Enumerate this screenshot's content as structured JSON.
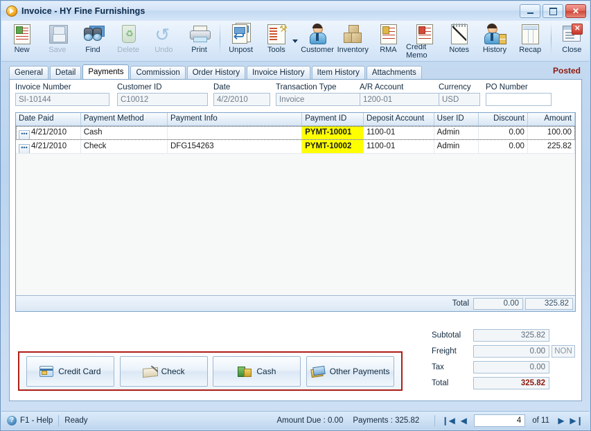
{
  "window": {
    "title": "Invoice - HY Fine Furnishings",
    "icon": "play-circle-icon",
    "controls": {
      "minimize": "minimize",
      "maximize": "maximize",
      "close": "close"
    }
  },
  "toolbar": {
    "items": [
      {
        "label": "New",
        "icon": "new-document-icon",
        "disabled": false
      },
      {
        "label": "Save",
        "icon": "floppy-disk-icon",
        "disabled": true
      },
      {
        "label": "Find",
        "icon": "binoculars-icon",
        "disabled": false
      },
      {
        "label": "Delete",
        "icon": "trash-can-icon",
        "disabled": true
      },
      {
        "label": "Undo",
        "icon": "undo-arrow-icon",
        "disabled": true
      },
      {
        "label": "Print",
        "icon": "printer-icon",
        "disabled": false
      },
      {
        "label": "Unpost",
        "icon": "unpost-pages-icon",
        "disabled": false
      },
      {
        "label": "Tools",
        "icon": "tools-wrench-icon",
        "disabled": false
      },
      {
        "label": "Customer",
        "icon": "person-icon",
        "disabled": false
      },
      {
        "label": "Inventory",
        "icon": "boxes-icon",
        "disabled": false
      },
      {
        "label": "RMA",
        "icon": "rma-document-icon",
        "disabled": false
      },
      {
        "label": "Credit Memo",
        "icon": "credit-memo-icon",
        "disabled": false
      },
      {
        "label": "Notes",
        "icon": "notepad-pen-icon",
        "disabled": false
      },
      {
        "label": "History",
        "icon": "person-hourglass-icon",
        "disabled": false
      },
      {
        "label": "Recap",
        "icon": "recap-grid-icon",
        "disabled": false
      },
      {
        "label": "Close",
        "icon": "close-window-icon",
        "disabled": false
      }
    ],
    "tools_dropdown": "chevron-down-icon"
  },
  "tabs": {
    "items": [
      {
        "label": "General",
        "active": false
      },
      {
        "label": "Detail",
        "active": false
      },
      {
        "label": "Payments",
        "active": true
      },
      {
        "label": "Commission",
        "active": false
      },
      {
        "label": "Order History",
        "active": false
      },
      {
        "label": "Invoice History",
        "active": false
      },
      {
        "label": "Item History",
        "active": false
      },
      {
        "label": "Attachments",
        "active": false
      }
    ],
    "status_badge": "Posted"
  },
  "header_fields": [
    {
      "label": "Invoice Number",
      "value": "SI-10144",
      "placeholder": ""
    },
    {
      "label": "Customer ID",
      "value": "C10012",
      "placeholder": ""
    },
    {
      "label": "Date",
      "value": "4/2/2010",
      "placeholder": ""
    },
    {
      "label": "Transaction Type",
      "value": "Invoice",
      "placeholder": ""
    },
    {
      "label": "A/R Account",
      "value": "1200-01",
      "placeholder": ""
    },
    {
      "label": "Currency",
      "value": "USD",
      "placeholder": ""
    },
    {
      "label": "PO Number",
      "value": "",
      "placeholder": ""
    }
  ],
  "grid": {
    "columns": [
      {
        "label": "Date Paid",
        "align": "left"
      },
      {
        "label": "Payment Method",
        "align": "left"
      },
      {
        "label": "Payment Info",
        "align": "left"
      },
      {
        "label": "Payment ID",
        "align": "left"
      },
      {
        "label": "Deposit Account",
        "align": "left"
      },
      {
        "label": "User ID",
        "align": "left"
      },
      {
        "label": "Discount",
        "align": "right"
      },
      {
        "label": "Amount",
        "align": "right"
      }
    ],
    "rows": [
      {
        "selected": true,
        "date_paid": "4/21/2010",
        "payment_method": "Cash",
        "payment_info": "",
        "payment_id": "PYMT-10001",
        "deposit_account": "1100-01",
        "user_id": "Admin",
        "discount": "0.00",
        "amount": "100.00"
      },
      {
        "selected": false,
        "date_paid": "4/21/2010",
        "payment_method": "Check",
        "payment_info": "DFG154263",
        "payment_id": "PYMT-10002",
        "deposit_account": "1100-01",
        "user_id": "Admin",
        "discount": "0.00",
        "amount": "225.82"
      }
    ],
    "footer": {
      "label": "Total",
      "discount_total": "0.00",
      "amount_total": "325.82"
    }
  },
  "payment_buttons": [
    {
      "label": "Credit Card",
      "icon": "credit-card-icon"
    },
    {
      "label": "Check",
      "icon": "check-icon"
    },
    {
      "label": "Cash",
      "icon": "cash-icon"
    },
    {
      "label": "Other Payments",
      "icon": "other-payments-icon"
    }
  ],
  "totals": [
    {
      "label": "Subtotal",
      "value": "325.82",
      "tag": "",
      "strong": false
    },
    {
      "label": "Freight",
      "value": "0.00",
      "tag": "NON",
      "strong": false
    },
    {
      "label": "Tax",
      "value": "0.00",
      "tag": "",
      "strong": false
    },
    {
      "label": "Total",
      "value": "325.82",
      "tag": "",
      "strong": true
    }
  ],
  "statusbar": {
    "help": "F1 - Help",
    "state": "Ready",
    "amount_due": "Amount Due : 0.00",
    "payments": "Payments : 325.82",
    "nav": {
      "first": "first-record",
      "prev": "previous-record",
      "page": "4",
      "of": "of  11",
      "next": "next-record",
      "last": "last-record"
    }
  },
  "colors": {
    "accent": "#1c5f9e",
    "posted": "#8b1a0e",
    "highlight": "#ffff00",
    "paybox_border": "#b01d16"
  }
}
